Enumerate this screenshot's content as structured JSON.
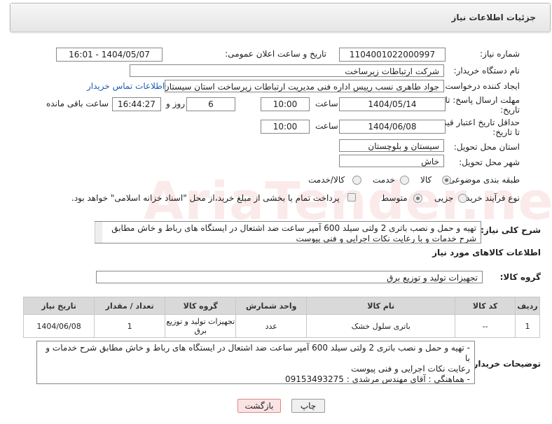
{
  "panel": {
    "title": "جزئیات اطلاعات نیاز"
  },
  "fields": {
    "need_number_label": "شماره نیاز:",
    "need_number": "1104001022000997",
    "announce_label": "تاریخ و ساعت اعلان عمومی:",
    "announce_value": "1404/05/07 - 16:01",
    "buyer_org_label": "نام دستگاه خریدار:",
    "buyer_org": "شرکت ارتباطات زیرساخت",
    "creator_label": "ایجاد کننده درخواست:",
    "creator": "جواد طاهری نسب رییس اداره فنی مدیریت ارتباطات زیرساخت استان سیستان و",
    "contact_link": "اطلاعات تماس خریدار",
    "deadline_label_1": "مهلت ارسال پاسخ: تا",
    "deadline_label_2": "تاریخ:",
    "deadline_date": "1404/05/14",
    "time_label": "ساعت",
    "deadline_time": "10:00",
    "days": "6",
    "days_label": "روز و",
    "remaining_time": "16:44:27",
    "remaining_label": "ساعت باقی مانده",
    "validity_label_1": "حداقل تاریخ اعتبار قیمت:",
    "validity_label_2": "تا تاریخ:",
    "validity_date": "1404/06/08",
    "validity_time": "10:00",
    "province_label": "استان محل تحویل:",
    "province": "سیستان و بلوچستان",
    "city_label": "شهر محل تحویل:",
    "city": "خاش",
    "category_label": "طبقه بندی موضوعی:",
    "category_options": [
      "کالا",
      "خدمت",
      "کالا/خدمت"
    ],
    "process_label": "نوع فرآیند خرید :",
    "process_options": [
      "جزیی",
      "متوسط"
    ],
    "payment_note": "پرداخت تمام یا بخشی از مبلغ خرید،از محل \"اسناد خزانه اسلامی\" خواهد بود."
  },
  "description": {
    "label": "شرح کلی نیاز:",
    "text": "تهیه و حمل و نصب باتری 2 ولتی سیلد 600  آمپر ساعت ضد اشتعال در ایستگاه های رباط و خاش مطابق شرح خدمات و با رعایت نکات اجرایی و فنی پیوست"
  },
  "goods": {
    "section_title": "اطلاعات کالاهای مورد نیاز",
    "group_label": "گروه کالا:",
    "group_value": "تجهیزات تولید و توزیع برق",
    "headers": [
      "ردیف",
      "کد کالا",
      "نام کالا",
      "واحد شمارش",
      "گروه کالا",
      "تعداد / مقدار",
      "تاریخ نیاز"
    ],
    "rows": [
      [
        "1",
        "--",
        "باتری سلول خشک",
        "عدد",
        "تجهیزات تولید و توزیع برق",
        "1",
        "1404/06/08"
      ]
    ]
  },
  "buyer_notes": {
    "label": "توضیحات خریدار:",
    "line1": "- تهیه و حمل و نصب باتری 2 ولتی سیلد 600  آمپر ساعت ضد اشتعال در ایستگاه های رباط و خاش مطابق شرح خدمات و با",
    "line2": "رعایت نکات اجرایی و فنی پیوست",
    "line3": "- هماهنگی : آقای مهندس مرشدی : 09153493275"
  },
  "buttons": {
    "print": "چاپ",
    "back": "بازگشت"
  },
  "watermark": "AriaTender.neT"
}
